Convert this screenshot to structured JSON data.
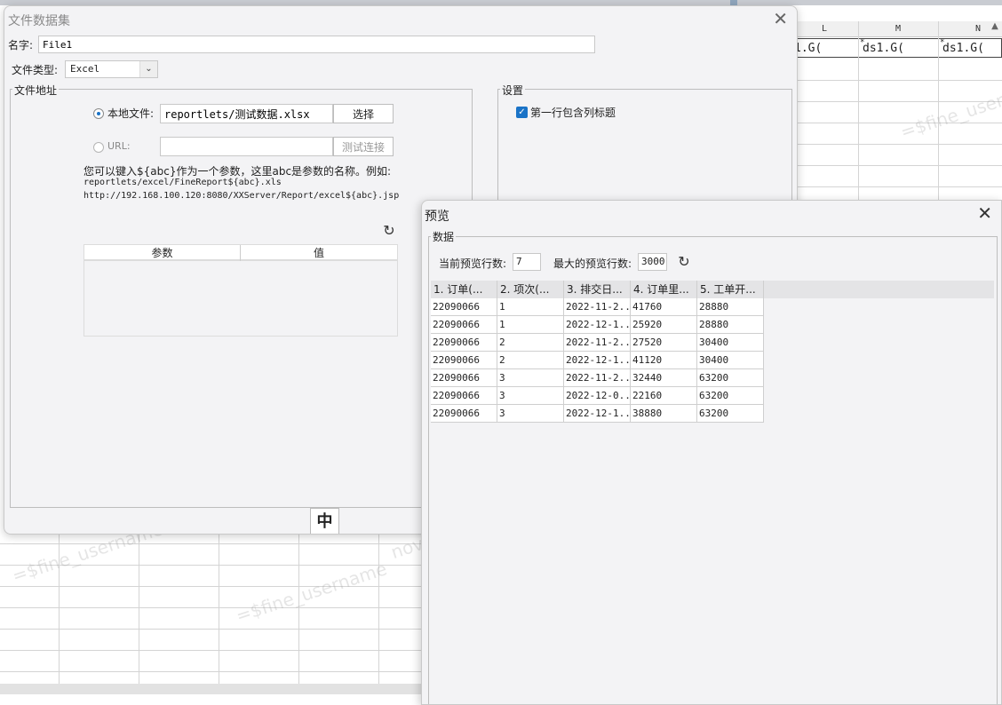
{
  "sheet": {
    "columns": [
      "L",
      "M",
      "N"
    ],
    "formulas": [
      "1.G(",
      "ds1.G(",
      "ds1.G("
    ],
    "formula_marker": "*",
    "scroll_up_glyph": "▲",
    "watermark": "=$fine_username",
    "watermark_short": "nov"
  },
  "file_dialog": {
    "title": "文件数据集",
    "close_glyph": "✕",
    "name_label": "名字:",
    "name_value": "File1",
    "filetype_label": "文件类型:",
    "filetype_value": "Excel",
    "filetype_arrow": "⌄",
    "address_group": "文件地址",
    "local_file_label": "本地文件:",
    "local_file_value": "reportlets/测试数据.xlsx",
    "choose_button": "选择",
    "url_label": "URL:",
    "url_value": "",
    "test_connection_button": "测试连接",
    "hint_line1": "您可以键入${abc}作为一个参数，这里abc是参数的名称。例如:",
    "hint_line2": "reportlets/excel/FineReport${abc}.xls",
    "hint_line3": "http://192.168.100.120:8080/XXServer/Report/excel${abc}.jsp",
    "refresh_glyph": "↻",
    "params_headers": [
      "参数",
      "值"
    ],
    "settings_group": "设置",
    "first_row_header_label": "第一行包含列标题",
    "first_row_header_checked": true,
    "checkbox_glyph": "✓",
    "ime_label": "中"
  },
  "preview_dialog": {
    "title": "预览",
    "close_glyph": "✕",
    "data_group": "数据",
    "current_rows_label": "当前预览行数:",
    "current_rows_value": "7",
    "max_rows_label": "最大的预览行数:",
    "max_rows_value": "3000",
    "refresh_glyph": "↻",
    "headers": [
      "1. 订单(...",
      "2. 项次(...",
      "3. 排交日...",
      "4. 订单里...",
      "5. 工单开..."
    ],
    "rows": [
      [
        "22090066",
        "1",
        "2022-11-2...",
        "41760",
        "28880"
      ],
      [
        "22090066",
        "1",
        "2022-12-1...",
        "25920",
        "28880"
      ],
      [
        "22090066",
        "2",
        "2022-11-2...",
        "27520",
        "30400"
      ],
      [
        "22090066",
        "2",
        "2022-12-1...",
        "41120",
        "30400"
      ],
      [
        "22090066",
        "3",
        "2022-11-2...",
        "32440",
        "63200"
      ],
      [
        "22090066",
        "3",
        "2022-12-0...",
        "22160",
        "63200"
      ],
      [
        "22090066",
        "3",
        "2022-12-1...",
        "38880",
        "63200"
      ]
    ]
  }
}
